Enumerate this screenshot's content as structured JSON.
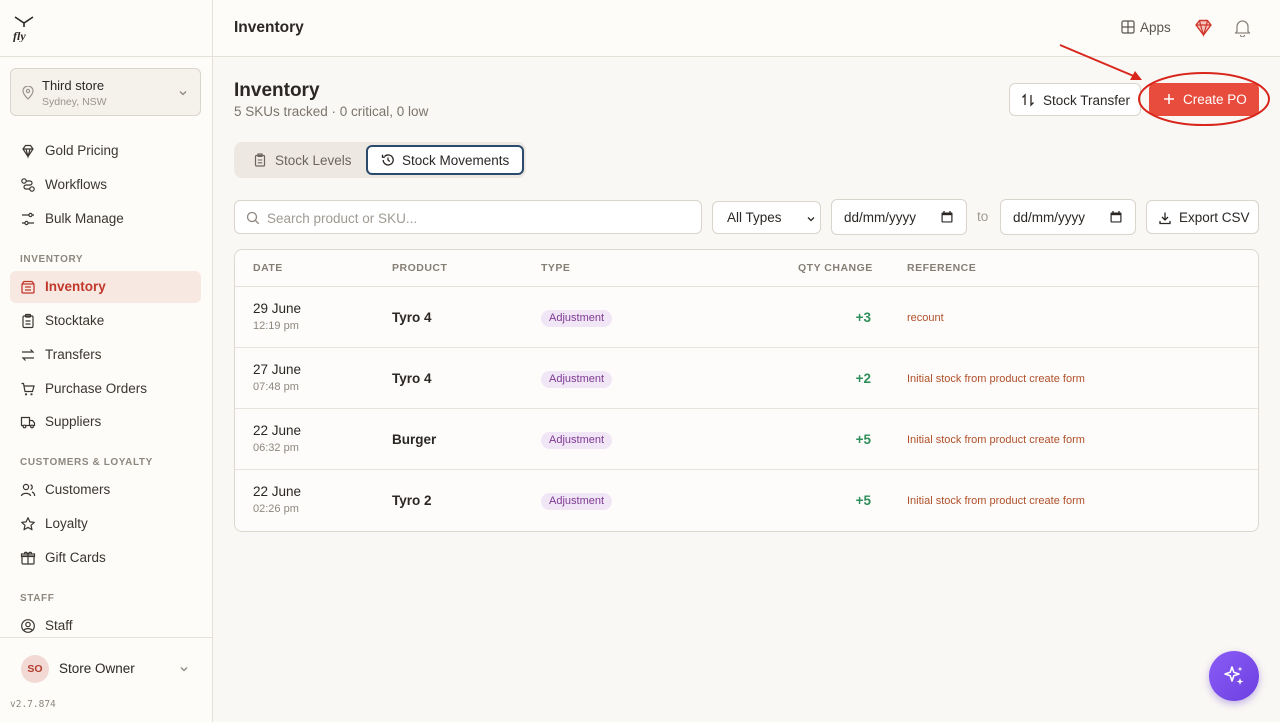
{
  "store": {
    "name": "Third store",
    "location": "Sydney, NSW"
  },
  "sidebar": {
    "top_items": [
      {
        "label": "Gold Pricing",
        "icon": "diamond-icon"
      },
      {
        "label": "Workflows",
        "icon": "workflow-icon"
      },
      {
        "label": "Bulk Manage",
        "icon": "sliders-icon"
      }
    ],
    "sections": {
      "inventory": "INVENTORY",
      "customers": "CUSTOMERS & LOYALTY",
      "staff": "STAFF"
    },
    "inventory_items": [
      {
        "label": "Inventory",
        "icon": "inventory-icon",
        "active": true
      },
      {
        "label": "Stocktake",
        "icon": "clipboard-icon"
      },
      {
        "label": "Transfers",
        "icon": "transfer-icon"
      },
      {
        "label": "Purchase Orders",
        "icon": "cart-icon"
      },
      {
        "label": "Suppliers",
        "icon": "truck-icon"
      }
    ],
    "customer_items": [
      {
        "label": "Customers",
        "icon": "users-icon"
      },
      {
        "label": "Loyalty",
        "icon": "star-icon"
      },
      {
        "label": "Gift Cards",
        "icon": "gift-icon"
      }
    ],
    "staff_items": [
      {
        "label": "Staff",
        "icon": "user-circle-icon"
      }
    ]
  },
  "user": {
    "initials": "SO",
    "name": "Store Owner"
  },
  "version": "v2.7.874",
  "topbar": {
    "title": "Inventory",
    "apps_label": "Apps"
  },
  "page": {
    "title": "Inventory",
    "subtitle": "5 SKUs tracked · 0 critical, 0 low"
  },
  "actions": {
    "stock_transfer": "Stock Transfer",
    "create_po": "Create PO",
    "export_csv": "Export CSV"
  },
  "tabs": [
    {
      "label": "Stock Levels",
      "icon": "clipboard-icon"
    },
    {
      "label": "Stock Movements",
      "icon": "history-icon",
      "active": true
    }
  ],
  "filters": {
    "search_placeholder": "Search product or SKU...",
    "type_selected": "All Types",
    "date_from": "dd/mm/yyyy",
    "to_label": "to",
    "date_to": "dd/mm/yyyy"
  },
  "table": {
    "columns": [
      "DATE",
      "PRODUCT",
      "TYPE",
      "QTY CHANGE",
      "REFERENCE"
    ],
    "rows": [
      {
        "date": "29 June",
        "time": "12:19 pm",
        "product": "Tyro 4",
        "type": "Adjustment",
        "qty": "+3",
        "reference": "recount"
      },
      {
        "date": "27 June",
        "time": "07:48 pm",
        "product": "Tyro 4",
        "type": "Adjustment",
        "qty": "+2",
        "reference": "Initial stock from product create form"
      },
      {
        "date": "22 June",
        "time": "06:32 pm",
        "product": "Burger",
        "type": "Adjustment",
        "qty": "+5",
        "reference": "Initial stock from product create form"
      },
      {
        "date": "22 June",
        "time": "02:26 pm",
        "product": "Tyro 2",
        "type": "Adjustment",
        "qty": "+5",
        "reference": "Initial stock from product create form"
      }
    ]
  },
  "colors": {
    "accent": "#e74c3c",
    "active_tab_border": "#2c4a6b",
    "badge_bg": "#f1e6f6",
    "qty_positive": "#2f8f5b",
    "annotation": "#d9261c"
  }
}
